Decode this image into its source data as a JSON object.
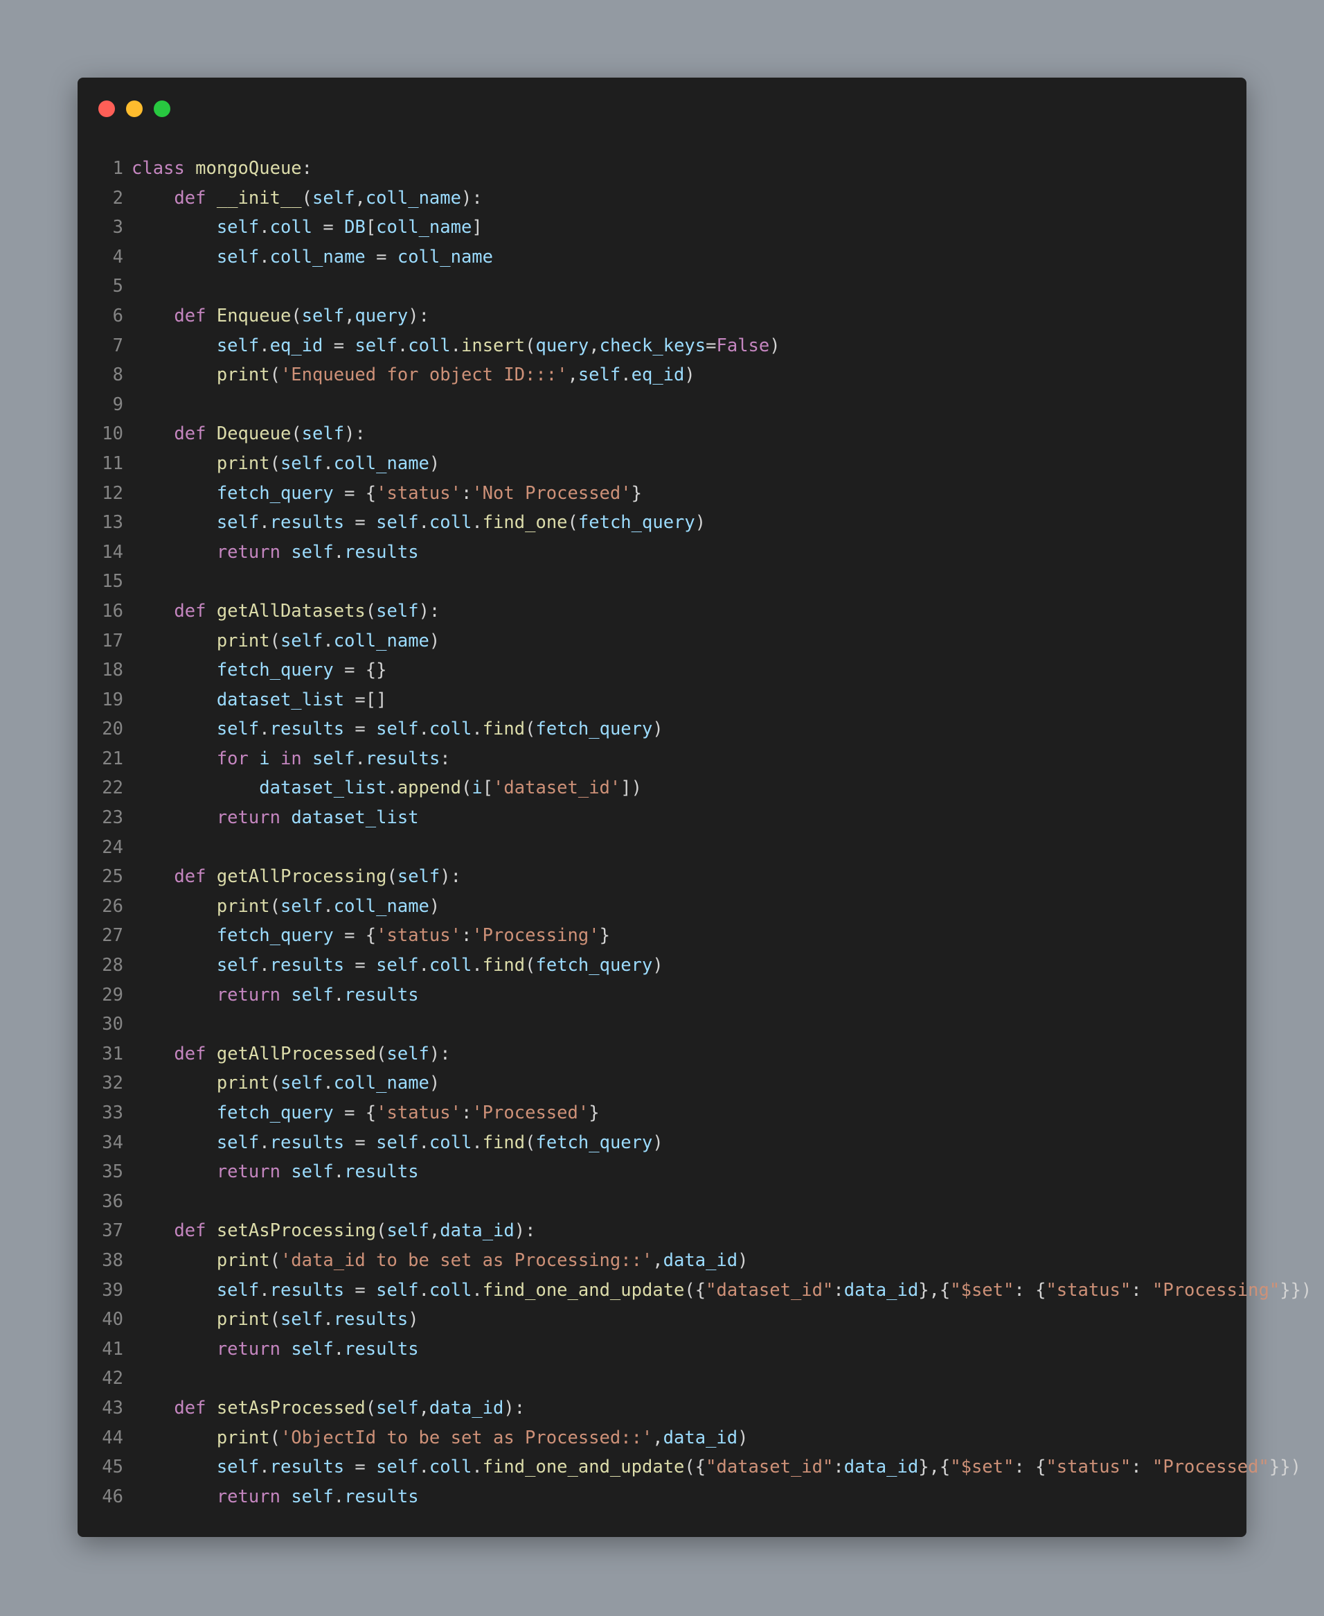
{
  "window": {
    "controls": [
      {
        "name": "close",
        "color": "#ff5f57"
      },
      {
        "name": "minimize",
        "color": "#febc2e"
      },
      {
        "name": "maximize",
        "color": "#28c840"
      }
    ]
  },
  "colors": {
    "k": "#c586c0",
    "f": "#dcdcaa",
    "v": "#9cdcfe",
    "s": "#ce9178",
    "t": "#d4d4d4"
  },
  "code_lines": [
    [
      [
        "k",
        "class"
      ],
      [
        "t",
        " "
      ],
      [
        "f",
        "mongoQueue"
      ],
      [
        "t",
        ":"
      ]
    ],
    [
      [
        "t",
        "    "
      ],
      [
        "k",
        "def"
      ],
      [
        "t",
        " "
      ],
      [
        "f",
        "__init__"
      ],
      [
        "t",
        "("
      ],
      [
        "v",
        "self"
      ],
      [
        "t",
        ","
      ],
      [
        "v",
        "coll_name"
      ],
      [
        "t",
        "):"
      ]
    ],
    [
      [
        "t",
        "        "
      ],
      [
        "v",
        "self"
      ],
      [
        "t",
        "."
      ],
      [
        "v",
        "coll"
      ],
      [
        "t",
        " = "
      ],
      [
        "v",
        "DB"
      ],
      [
        "t",
        "["
      ],
      [
        "v",
        "coll_name"
      ],
      [
        "t",
        "]"
      ]
    ],
    [
      [
        "t",
        "        "
      ],
      [
        "v",
        "self"
      ],
      [
        "t",
        "."
      ],
      [
        "v",
        "coll_name"
      ],
      [
        "t",
        " = "
      ],
      [
        "v",
        "coll_name"
      ]
    ],
    [],
    [
      [
        "t",
        "    "
      ],
      [
        "k",
        "def"
      ],
      [
        "t",
        " "
      ],
      [
        "f",
        "Enqueue"
      ],
      [
        "t",
        "("
      ],
      [
        "v",
        "self"
      ],
      [
        "t",
        ","
      ],
      [
        "v",
        "query"
      ],
      [
        "t",
        "):"
      ]
    ],
    [
      [
        "t",
        "        "
      ],
      [
        "v",
        "self"
      ],
      [
        "t",
        "."
      ],
      [
        "v",
        "eq_id"
      ],
      [
        "t",
        " = "
      ],
      [
        "v",
        "self"
      ],
      [
        "t",
        "."
      ],
      [
        "v",
        "coll"
      ],
      [
        "t",
        "."
      ],
      [
        "f",
        "insert"
      ],
      [
        "t",
        "("
      ],
      [
        "v",
        "query"
      ],
      [
        "t",
        ","
      ],
      [
        "v",
        "check_keys"
      ],
      [
        "t",
        "="
      ],
      [
        "k",
        "False"
      ],
      [
        "t",
        ")"
      ]
    ],
    [
      [
        "t",
        "        "
      ],
      [
        "f",
        "print"
      ],
      [
        "t",
        "("
      ],
      [
        "s",
        "'Enqueued for object ID:::'"
      ],
      [
        "t",
        ","
      ],
      [
        "v",
        "self"
      ],
      [
        "t",
        "."
      ],
      [
        "v",
        "eq_id"
      ],
      [
        "t",
        ")"
      ]
    ],
    [],
    [
      [
        "t",
        "    "
      ],
      [
        "k",
        "def"
      ],
      [
        "t",
        " "
      ],
      [
        "f",
        "Dequeue"
      ],
      [
        "t",
        "("
      ],
      [
        "v",
        "self"
      ],
      [
        "t",
        "):"
      ]
    ],
    [
      [
        "t",
        "        "
      ],
      [
        "f",
        "print"
      ],
      [
        "t",
        "("
      ],
      [
        "v",
        "self"
      ],
      [
        "t",
        "."
      ],
      [
        "v",
        "coll_name"
      ],
      [
        "t",
        ")"
      ]
    ],
    [
      [
        "t",
        "        "
      ],
      [
        "v",
        "fetch_query"
      ],
      [
        "t",
        " = {"
      ],
      [
        "s",
        "'status'"
      ],
      [
        "t",
        ":"
      ],
      [
        "s",
        "'Not Processed'"
      ],
      [
        "t",
        "}"
      ]
    ],
    [
      [
        "t",
        "        "
      ],
      [
        "v",
        "self"
      ],
      [
        "t",
        "."
      ],
      [
        "v",
        "results"
      ],
      [
        "t",
        " = "
      ],
      [
        "v",
        "self"
      ],
      [
        "t",
        "."
      ],
      [
        "v",
        "coll"
      ],
      [
        "t",
        "."
      ],
      [
        "f",
        "find_one"
      ],
      [
        "t",
        "("
      ],
      [
        "v",
        "fetch_query"
      ],
      [
        "t",
        ")"
      ]
    ],
    [
      [
        "t",
        "        "
      ],
      [
        "k",
        "return"
      ],
      [
        "t",
        " "
      ],
      [
        "v",
        "self"
      ],
      [
        "t",
        "."
      ],
      [
        "v",
        "results"
      ]
    ],
    [],
    [
      [
        "t",
        "    "
      ],
      [
        "k",
        "def"
      ],
      [
        "t",
        " "
      ],
      [
        "f",
        "getAllDatasets"
      ],
      [
        "t",
        "("
      ],
      [
        "v",
        "self"
      ],
      [
        "t",
        "):"
      ]
    ],
    [
      [
        "t",
        "        "
      ],
      [
        "f",
        "print"
      ],
      [
        "t",
        "("
      ],
      [
        "v",
        "self"
      ],
      [
        "t",
        "."
      ],
      [
        "v",
        "coll_name"
      ],
      [
        "t",
        ")"
      ]
    ],
    [
      [
        "t",
        "        "
      ],
      [
        "v",
        "fetch_query"
      ],
      [
        "t",
        " = {}"
      ]
    ],
    [
      [
        "t",
        "        "
      ],
      [
        "v",
        "dataset_list"
      ],
      [
        "t",
        " =[]"
      ]
    ],
    [
      [
        "t",
        "        "
      ],
      [
        "v",
        "self"
      ],
      [
        "t",
        "."
      ],
      [
        "v",
        "results"
      ],
      [
        "t",
        " = "
      ],
      [
        "v",
        "self"
      ],
      [
        "t",
        "."
      ],
      [
        "v",
        "coll"
      ],
      [
        "t",
        "."
      ],
      [
        "f",
        "find"
      ],
      [
        "t",
        "("
      ],
      [
        "v",
        "fetch_query"
      ],
      [
        "t",
        ")"
      ]
    ],
    [
      [
        "t",
        "        "
      ],
      [
        "k",
        "for"
      ],
      [
        "t",
        " "
      ],
      [
        "v",
        "i"
      ],
      [
        "t",
        " "
      ],
      [
        "k",
        "in"
      ],
      [
        "t",
        " "
      ],
      [
        "v",
        "self"
      ],
      [
        "t",
        "."
      ],
      [
        "v",
        "results"
      ],
      [
        "t",
        ":"
      ]
    ],
    [
      [
        "t",
        "            "
      ],
      [
        "v",
        "dataset_list"
      ],
      [
        "t",
        "."
      ],
      [
        "f",
        "append"
      ],
      [
        "t",
        "("
      ],
      [
        "v",
        "i"
      ],
      [
        "t",
        "["
      ],
      [
        "s",
        "'dataset_id'"
      ],
      [
        "t",
        "])"
      ]
    ],
    [
      [
        "t",
        "        "
      ],
      [
        "k",
        "return"
      ],
      [
        "t",
        " "
      ],
      [
        "v",
        "dataset_list"
      ]
    ],
    [],
    [
      [
        "t",
        "    "
      ],
      [
        "k",
        "def"
      ],
      [
        "t",
        " "
      ],
      [
        "f",
        "getAllProcessing"
      ],
      [
        "t",
        "("
      ],
      [
        "v",
        "self"
      ],
      [
        "t",
        "):"
      ]
    ],
    [
      [
        "t",
        "        "
      ],
      [
        "f",
        "print"
      ],
      [
        "t",
        "("
      ],
      [
        "v",
        "self"
      ],
      [
        "t",
        "."
      ],
      [
        "v",
        "coll_name"
      ],
      [
        "t",
        ")"
      ]
    ],
    [
      [
        "t",
        "        "
      ],
      [
        "v",
        "fetch_query"
      ],
      [
        "t",
        " = {"
      ],
      [
        "s",
        "'status'"
      ],
      [
        "t",
        ":"
      ],
      [
        "s",
        "'Processing'"
      ],
      [
        "t",
        "}"
      ]
    ],
    [
      [
        "t",
        "        "
      ],
      [
        "v",
        "self"
      ],
      [
        "t",
        "."
      ],
      [
        "v",
        "results"
      ],
      [
        "t",
        " = "
      ],
      [
        "v",
        "self"
      ],
      [
        "t",
        "."
      ],
      [
        "v",
        "coll"
      ],
      [
        "t",
        "."
      ],
      [
        "f",
        "find"
      ],
      [
        "t",
        "("
      ],
      [
        "v",
        "fetch_query"
      ],
      [
        "t",
        ")"
      ]
    ],
    [
      [
        "t",
        "        "
      ],
      [
        "k",
        "return"
      ],
      [
        "t",
        " "
      ],
      [
        "v",
        "self"
      ],
      [
        "t",
        "."
      ],
      [
        "v",
        "results"
      ]
    ],
    [],
    [
      [
        "t",
        "    "
      ],
      [
        "k",
        "def"
      ],
      [
        "t",
        " "
      ],
      [
        "f",
        "getAllProcessed"
      ],
      [
        "t",
        "("
      ],
      [
        "v",
        "self"
      ],
      [
        "t",
        "):"
      ]
    ],
    [
      [
        "t",
        "        "
      ],
      [
        "f",
        "print"
      ],
      [
        "t",
        "("
      ],
      [
        "v",
        "self"
      ],
      [
        "t",
        "."
      ],
      [
        "v",
        "coll_name"
      ],
      [
        "t",
        ")"
      ]
    ],
    [
      [
        "t",
        "        "
      ],
      [
        "v",
        "fetch_query"
      ],
      [
        "t",
        " = {"
      ],
      [
        "s",
        "'status'"
      ],
      [
        "t",
        ":"
      ],
      [
        "s",
        "'Processed'"
      ],
      [
        "t",
        "}"
      ]
    ],
    [
      [
        "t",
        "        "
      ],
      [
        "v",
        "self"
      ],
      [
        "t",
        "."
      ],
      [
        "v",
        "results"
      ],
      [
        "t",
        " = "
      ],
      [
        "v",
        "self"
      ],
      [
        "t",
        "."
      ],
      [
        "v",
        "coll"
      ],
      [
        "t",
        "."
      ],
      [
        "f",
        "find"
      ],
      [
        "t",
        "("
      ],
      [
        "v",
        "fetch_query"
      ],
      [
        "t",
        ")"
      ]
    ],
    [
      [
        "t",
        "        "
      ],
      [
        "k",
        "return"
      ],
      [
        "t",
        " "
      ],
      [
        "v",
        "self"
      ],
      [
        "t",
        "."
      ],
      [
        "v",
        "results"
      ]
    ],
    [],
    [
      [
        "t",
        "    "
      ],
      [
        "k",
        "def"
      ],
      [
        "t",
        " "
      ],
      [
        "f",
        "setAsProcessing"
      ],
      [
        "t",
        "("
      ],
      [
        "v",
        "self"
      ],
      [
        "t",
        ","
      ],
      [
        "v",
        "data_id"
      ],
      [
        "t",
        "):"
      ]
    ],
    [
      [
        "t",
        "        "
      ],
      [
        "f",
        "print"
      ],
      [
        "t",
        "("
      ],
      [
        "s",
        "'data_id to be set as Processing::'"
      ],
      [
        "t",
        ","
      ],
      [
        "v",
        "data_id"
      ],
      [
        "t",
        ")"
      ]
    ],
    [
      [
        "t",
        "        "
      ],
      [
        "v",
        "self"
      ],
      [
        "t",
        "."
      ],
      [
        "v",
        "results"
      ],
      [
        "t",
        " = "
      ],
      [
        "v",
        "self"
      ],
      [
        "t",
        "."
      ],
      [
        "v",
        "coll"
      ],
      [
        "t",
        "."
      ],
      [
        "f",
        "find_one_and_update"
      ],
      [
        "t",
        "({"
      ],
      [
        "s",
        "\"dataset_id\""
      ],
      [
        "t",
        ":"
      ],
      [
        "v",
        "data_id"
      ],
      [
        "t",
        "},{"
      ],
      [
        "s",
        "\"$set\""
      ],
      [
        "t",
        ": {"
      ],
      [
        "s",
        "\"status\""
      ],
      [
        "t",
        ": "
      ],
      [
        "s",
        "\"Processing\""
      ],
      [
        "t",
        "}})"
      ]
    ],
    [
      [
        "t",
        "        "
      ],
      [
        "f",
        "print"
      ],
      [
        "t",
        "("
      ],
      [
        "v",
        "self"
      ],
      [
        "t",
        "."
      ],
      [
        "v",
        "results"
      ],
      [
        "t",
        ")"
      ]
    ],
    [
      [
        "t",
        "        "
      ],
      [
        "k",
        "return"
      ],
      [
        "t",
        " "
      ],
      [
        "v",
        "self"
      ],
      [
        "t",
        "."
      ],
      [
        "v",
        "results"
      ]
    ],
    [],
    [
      [
        "t",
        "    "
      ],
      [
        "k",
        "def"
      ],
      [
        "t",
        " "
      ],
      [
        "f",
        "setAsProcessed"
      ],
      [
        "t",
        "("
      ],
      [
        "v",
        "self"
      ],
      [
        "t",
        ","
      ],
      [
        "v",
        "data_id"
      ],
      [
        "t",
        "):"
      ]
    ],
    [
      [
        "t",
        "        "
      ],
      [
        "f",
        "print"
      ],
      [
        "t",
        "("
      ],
      [
        "s",
        "'ObjectId to be set as Processed::'"
      ],
      [
        "t",
        ","
      ],
      [
        "v",
        "data_id"
      ],
      [
        "t",
        ")"
      ]
    ],
    [
      [
        "t",
        "        "
      ],
      [
        "v",
        "self"
      ],
      [
        "t",
        "."
      ],
      [
        "v",
        "results"
      ],
      [
        "t",
        " = "
      ],
      [
        "v",
        "self"
      ],
      [
        "t",
        "."
      ],
      [
        "v",
        "coll"
      ],
      [
        "t",
        "."
      ],
      [
        "f",
        "find_one_and_update"
      ],
      [
        "t",
        "({"
      ],
      [
        "s",
        "\"dataset_id\""
      ],
      [
        "t",
        ":"
      ],
      [
        "v",
        "data_id"
      ],
      [
        "t",
        "},{"
      ],
      [
        "s",
        "\"$set\""
      ],
      [
        "t",
        ": {"
      ],
      [
        "s",
        "\"status\""
      ],
      [
        "t",
        ": "
      ],
      [
        "s",
        "\"Processed\""
      ],
      [
        "t",
        "}})"
      ]
    ],
    [
      [
        "t",
        "        "
      ],
      [
        "k",
        "return"
      ],
      [
        "t",
        " "
      ],
      [
        "v",
        "self"
      ],
      [
        "t",
        "."
      ],
      [
        "v",
        "results"
      ]
    ]
  ]
}
